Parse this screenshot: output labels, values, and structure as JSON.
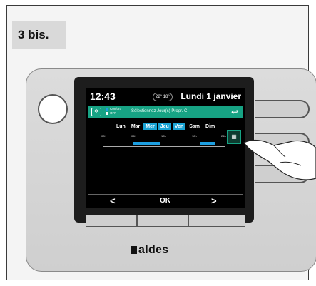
{
  "step_label": "3 bis.",
  "brand": "aldes",
  "screen": {
    "time": "12:43",
    "temp_indicator": "22° 18°",
    "date": "Lundi 1 janvier",
    "legend": [
      "Confort",
      "OFF"
    ],
    "instruction": "Sélectionnez Jour(s) Progr. C",
    "back_icon": "back-arrow-icon",
    "days": [
      {
        "label": "Lun",
        "selected": false
      },
      {
        "label": "Mar",
        "selected": false
      },
      {
        "label": "Mer",
        "selected": true
      },
      {
        "label": "Jeu",
        "selected": true
      },
      {
        "label": "Ven",
        "selected": true
      },
      {
        "label": "Sam",
        "selected": false
      },
      {
        "label": "Dim",
        "selected": false
      }
    ],
    "timeline_labels": [
      "00h",
      "06h",
      "12h",
      "18h",
      "24h"
    ],
    "calendar_icon": "calendar-icon",
    "nav": {
      "prev": "<",
      "ok": "OK",
      "next": ">"
    }
  },
  "colors": {
    "accent": "#17a384",
    "selected_day": "#19a3d4",
    "comfort": "#1c9ee0"
  }
}
